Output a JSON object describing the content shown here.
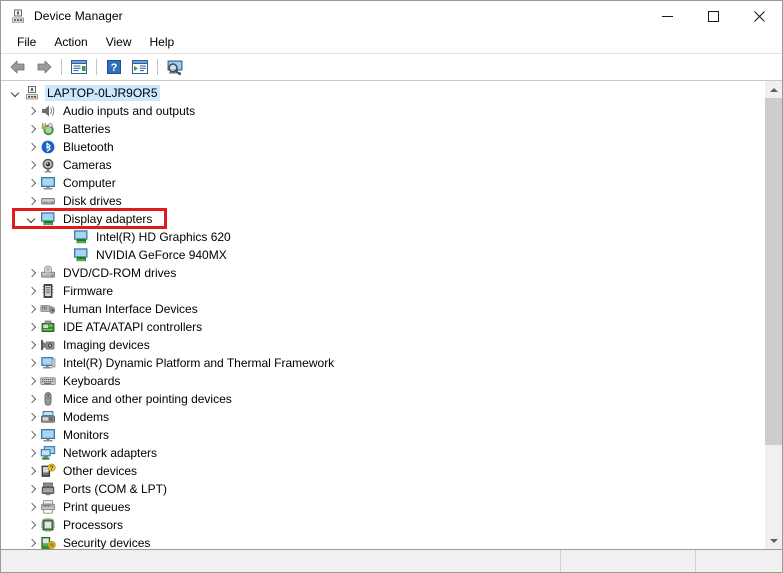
{
  "window": {
    "title": "Device Manager",
    "icon": "device-manager-icon",
    "controls": {
      "minimize": "minimize-button",
      "maximize": "maximize-button",
      "close": "close-button"
    }
  },
  "menubar": {
    "items": [
      {
        "label": "File",
        "name": "menu-file"
      },
      {
        "label": "Action",
        "name": "menu-action"
      },
      {
        "label": "View",
        "name": "menu-view"
      },
      {
        "label": "Help",
        "name": "menu-help"
      }
    ]
  },
  "toolbar": {
    "buttons": [
      {
        "name": "back-button",
        "icon": "back-arrow-icon"
      },
      {
        "name": "forward-button",
        "icon": "forward-arrow-icon"
      },
      {
        "name": "properties-button",
        "icon": "properties-icon"
      },
      {
        "name": "help-button",
        "icon": "help-question-icon"
      },
      {
        "name": "update-driver-button",
        "icon": "update-driver-icon"
      },
      {
        "name": "scan-hardware-changes-button",
        "icon": "scan-hardware-icon"
      }
    ]
  },
  "tree": {
    "root": {
      "label": "LAPTOP-0LJR9OR5",
      "icon": "computer-node-icon",
      "expanded": true,
      "selected": true
    },
    "items": [
      {
        "label": "Audio inputs and outputs",
        "icon": "speaker-icon",
        "level": 1,
        "expandable": true,
        "expanded": false
      },
      {
        "label": "Batteries",
        "icon": "battery-icon",
        "level": 1,
        "expandable": true,
        "expanded": false
      },
      {
        "label": "Bluetooth",
        "icon": "bluetooth-icon",
        "level": 1,
        "expandable": true,
        "expanded": false
      },
      {
        "label": "Cameras",
        "icon": "camera-icon",
        "level": 1,
        "expandable": true,
        "expanded": false
      },
      {
        "label": "Computer",
        "icon": "monitor-icon",
        "level": 1,
        "expandable": true,
        "expanded": false
      },
      {
        "label": "Disk drives",
        "icon": "disk-drive-icon",
        "level": 1,
        "expandable": true,
        "expanded": false
      },
      {
        "label": "Display adapters",
        "icon": "display-adapter-icon",
        "level": 1,
        "expandable": true,
        "expanded": true,
        "highlighted": true
      },
      {
        "label": "Intel(R) HD Graphics 620",
        "icon": "display-adapter-icon",
        "level": 2,
        "expandable": false,
        "expanded": false
      },
      {
        "label": "NVIDIA GeForce 940MX",
        "icon": "display-adapter-icon",
        "level": 2,
        "expandable": false,
        "expanded": false
      },
      {
        "label": "DVD/CD-ROM drives",
        "icon": "dvd-drive-icon",
        "level": 1,
        "expandable": true,
        "expanded": false
      },
      {
        "label": "Firmware",
        "icon": "firmware-icon",
        "level": 1,
        "expandable": true,
        "expanded": false
      },
      {
        "label": "Human Interface Devices",
        "icon": "hid-icon",
        "level": 1,
        "expandable": true,
        "expanded": false
      },
      {
        "label": "IDE ATA/ATAPI controllers",
        "icon": "ide-controller-icon",
        "level": 1,
        "expandable": true,
        "expanded": false
      },
      {
        "label": "Imaging devices",
        "icon": "imaging-device-icon",
        "level": 1,
        "expandable": true,
        "expanded": false
      },
      {
        "label": "Intel(R) Dynamic Platform and Thermal Framework",
        "icon": "thermal-framework-icon",
        "level": 1,
        "expandable": true,
        "expanded": false
      },
      {
        "label": "Keyboards",
        "icon": "keyboard-icon",
        "level": 1,
        "expandable": true,
        "expanded": false
      },
      {
        "label": "Mice and other pointing devices",
        "icon": "mouse-icon",
        "level": 1,
        "expandable": true,
        "expanded": false
      },
      {
        "label": "Modems",
        "icon": "modem-icon",
        "level": 1,
        "expandable": true,
        "expanded": false
      },
      {
        "label": "Monitors",
        "icon": "monitor-icon",
        "level": 1,
        "expandable": true,
        "expanded": false
      },
      {
        "label": "Network adapters",
        "icon": "network-adapter-icon",
        "level": 1,
        "expandable": true,
        "expanded": false
      },
      {
        "label": "Other devices",
        "icon": "other-device-icon",
        "level": 1,
        "expandable": true,
        "expanded": false
      },
      {
        "label": "Ports (COM & LPT)",
        "icon": "port-icon",
        "level": 1,
        "expandable": true,
        "expanded": false
      },
      {
        "label": "Print queues",
        "icon": "printer-icon",
        "level": 1,
        "expandable": true,
        "expanded": false
      },
      {
        "label": "Processors",
        "icon": "processor-icon",
        "level": 1,
        "expandable": true,
        "expanded": false
      },
      {
        "label": "Security devices",
        "icon": "security-device-icon",
        "level": 1,
        "expandable": true,
        "expanded": false
      }
    ]
  },
  "scrollbar": {
    "up_arrow": "scroll-up-arrow",
    "down_arrow": "scroll-down-arrow",
    "thumb": "scroll-thumb"
  },
  "statusbar": {
    "pane1": "",
    "pane2": "",
    "pane3": ""
  },
  "annotation": {
    "color": "#e01b1b",
    "target": "Display adapters"
  }
}
